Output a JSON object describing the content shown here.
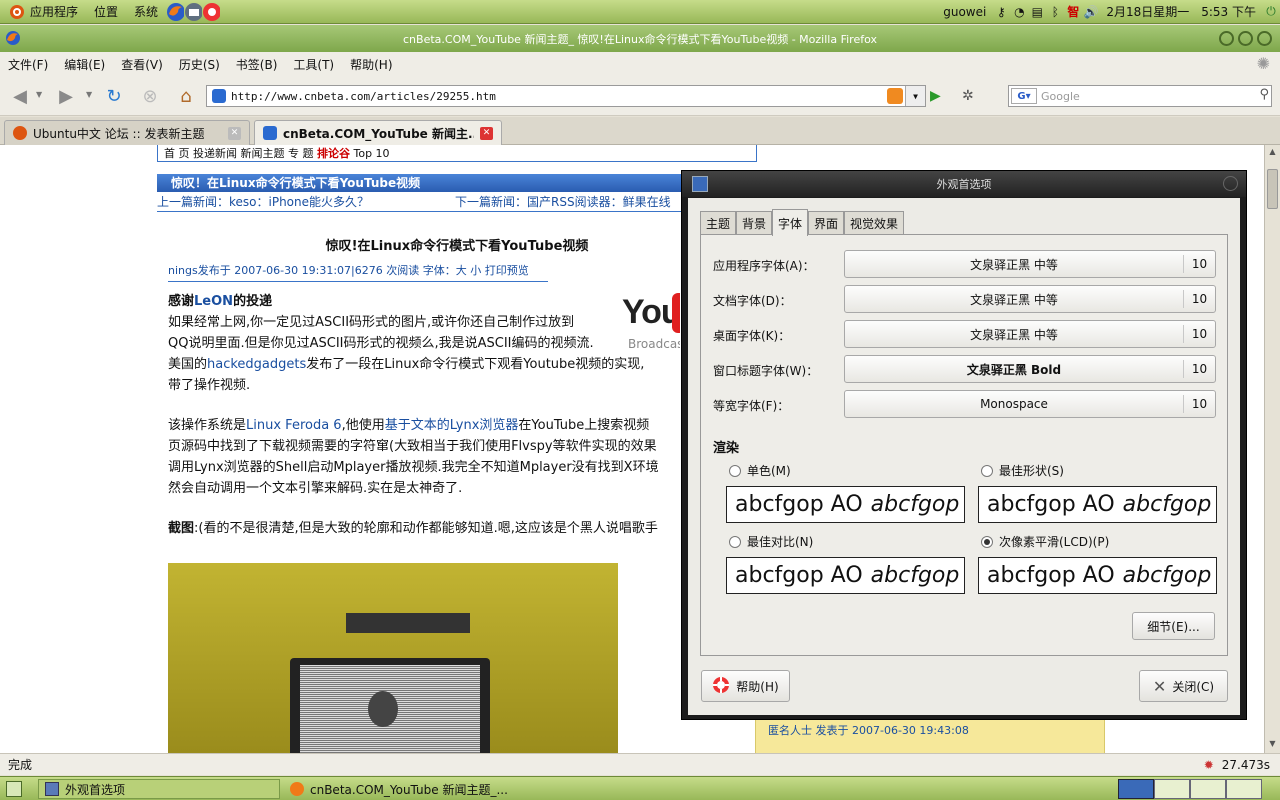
{
  "top_panel": {
    "applications": "应用程序",
    "places": "位置",
    "system": "系统",
    "username": "guowei",
    "date": "2月18日星期一",
    "time": "5:53 下午"
  },
  "window_title": "cnBeta.COM_YouTube 新闻主题_ 惊叹!在Linux命令行模式下看YouTube视频 - Mozilla Firefox",
  "menu": [
    "文件(F)",
    "编辑(E)",
    "查看(V)",
    "历史(S)",
    "书签(B)",
    "工具(T)",
    "帮助(H)"
  ],
  "url": "http://www.cnbeta.com/articles/29255.htm",
  "search_placeholder": "Google",
  "tabs": [
    {
      "label": "Ubuntu中文 论坛 :: 发表新主题",
      "active": false
    },
    {
      "label": "cnBeta.COM_YouTube 新闻主...",
      "active": true
    }
  ],
  "article": {
    "topnav": "首 页  投递新闻  新闻主题  专 题  ",
    "topnav_hot": "排论谷",
    "topnav_top": "Top 10",
    "header": "惊叹！在Linux命令行模式下看YouTube视频",
    "prev": "上一篇新闻：keso：iPhone能火多久？",
    "next": "下一篇新闻：国产RSS阅读器：鲜果在线",
    "title": "惊叹!在Linux命令行模式下看YouTube视频",
    "meta": "nings发布于  2007-06-30  19:31:07|6276  次阅读  字体：大  小  打印预览",
    "thanks_prefix": "感谢",
    "thanks_name": "LeON",
    "thanks_suffix": "的投递",
    "p1_a": "如果经常上网,你一定见过ASCII码形式的图片,或许你还自己制作过放到",
    "p1_b": "QQ说明里面.但是你见过ASCII码形式的视频么,我是说ASCII编码的视频流.",
    "p1_c_pre": "美国的",
    "p1_c_link": "hackedgadgets",
    "p1_c_post": "发布了一段在Linux命令行模式下观看Youtube视频的实现,",
    "p1_d": "带了操作视频.",
    "p2_a_pre": "该操作系统是",
    "p2_a_link1": "Linux Feroda 6",
    "p2_a_mid": ",他使用",
    "p2_a_link2": "基于文本的Lynx浏览器",
    "p2_a_post": "在YouTube上搜索视频",
    "p2_b": "页源码中找到了下载视频需要的字符窜(大致相当于我们使用Flvspy等软件实现的效果",
    "p2_c": "调用Lynx浏览器的Shell启动Mplayer播放视频.我完全不知道Mplayer没有找到X环境",
    "p2_d": "然会自动调用一个文本引擎来解码.实在是太神奇了.",
    "p3_bold": "截图",
    "p3_text": ":(看的不是很清楚,但是大致的轮廓和动作都能够知道.嗯,这应该是个黑人说唱歌手",
    "logo_text": "You",
    "logo_sub": "Broadcas",
    "comment_author": "匿名人士  发表于  2007-06-30  19:43:08"
  },
  "status": {
    "text": "完成",
    "timer": "27.473s"
  },
  "taskbar": [
    {
      "label": "外观首选项"
    },
    {
      "label": "cnBeta.COM_YouTube 新闻主题_..."
    }
  ],
  "dialog": {
    "title": "外观首选项",
    "tabs": [
      "主题",
      "背景",
      "字体",
      "界面",
      "视觉效果"
    ],
    "active_tab": "字体",
    "fonts": [
      {
        "label": "应用程序字体(A)：",
        "font": "文泉驿正黑  中等",
        "size": "10"
      },
      {
        "label": "文档字体(D)：",
        "font": "文泉驿正黑  中等",
        "size": "10"
      },
      {
        "label": "桌面字体(K)：",
        "font": "文泉驿正黑  中等",
        "size": "10"
      },
      {
        "label": "窗口标题字体(W)：",
        "font": "文泉驿正黑  Bold",
        "size": "10"
      },
      {
        "label": "等宽字体(F)：",
        "font": "Monospace",
        "size": "10"
      }
    ],
    "render_heading": "渲染",
    "render_options": [
      {
        "label": "单色(M)",
        "selected": false
      },
      {
        "label": "最佳形状(S)",
        "selected": false
      },
      {
        "label": "最佳对比(N)",
        "selected": false
      },
      {
        "label": "次像素平滑(LCD)(P)",
        "selected": true
      }
    ],
    "sample_plain": "abcfgop AO",
    "sample_italic": "abcfgop",
    "details_button": "细节(E)...",
    "help_button": "帮助(H)",
    "close_button": "关闭(C)"
  },
  "colors": {
    "panel_green": "#a8c86a",
    "link_blue": "#1a4fa0",
    "header_blue": "#3a74c8",
    "youtube_red": "#e02020"
  }
}
